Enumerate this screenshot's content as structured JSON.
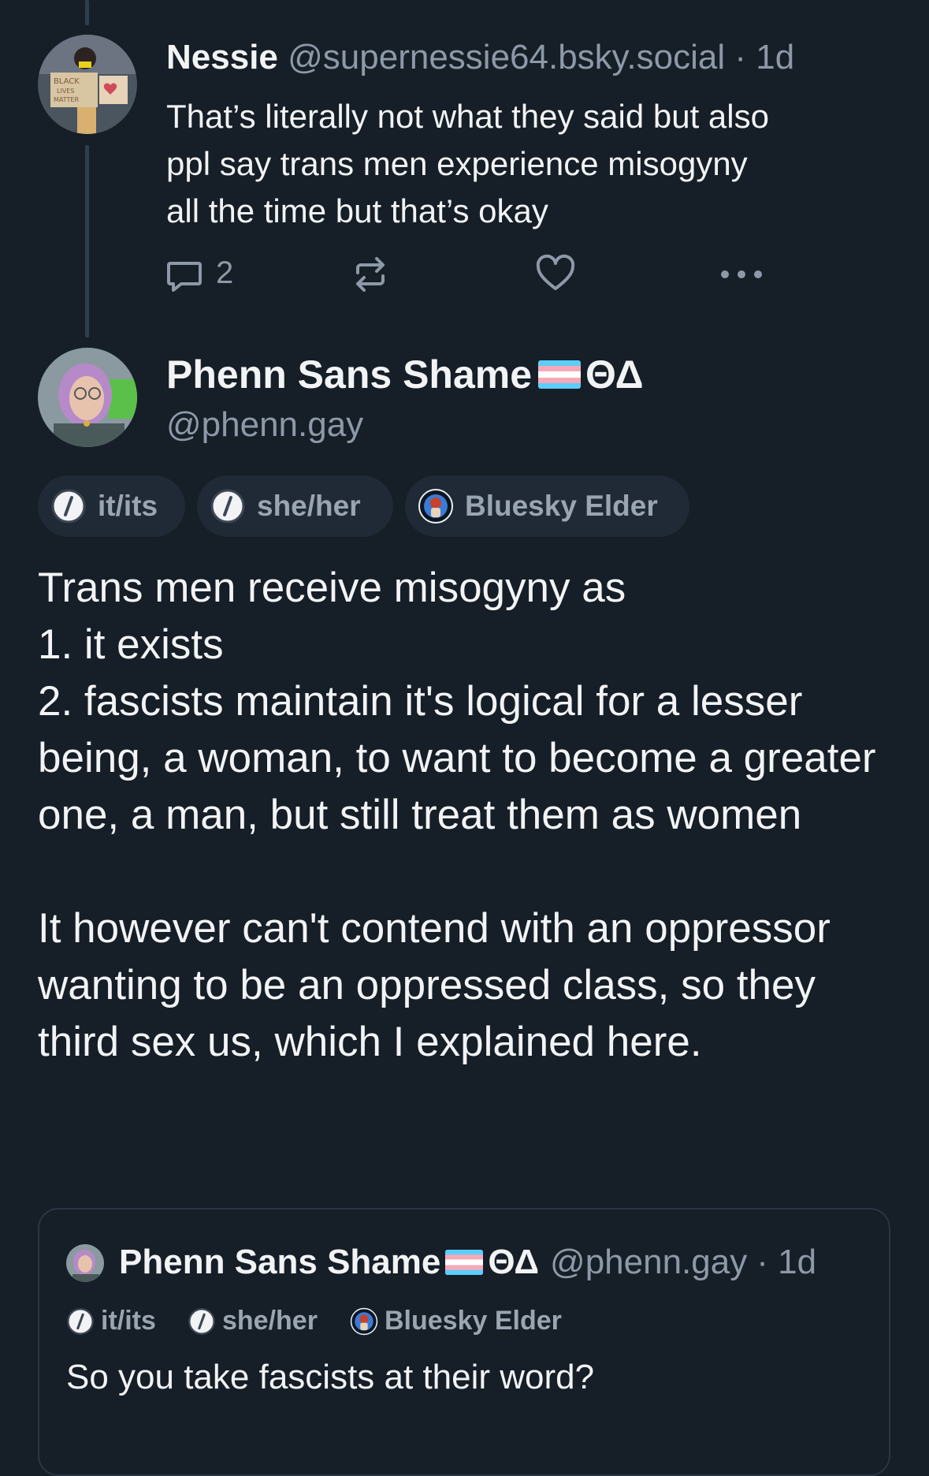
{
  "post1": {
    "author_name": "Nessie",
    "author_handle": "@supernessie64.bsky.social",
    "time": "· 1d",
    "text_lines": [
      "That’s literally not what they said but also",
      "ppl say trans men experience misogyny",
      "all the time but that’s okay"
    ],
    "reply_count": "2"
  },
  "post2": {
    "author_name": "Phenn Sans Shame",
    "name_suffix": "ΘΔ",
    "author_handle": "@phenn.gay",
    "badges": [
      "it/its",
      "she/her",
      "Bluesky Elder"
    ],
    "body": "Trans men receive misogyny as\n1. it exists\n2. fascists maintain it's logical for a lesser being, a woman, to want to become a greater one, a man, but still treat them as women\n\nIt however can't contend with an oppressor wanting to be an oppressed class, so they third sex us, which I explained here."
  },
  "quote": {
    "author_name": "Phenn Sans Shame",
    "name_suffix": "ΘΔ",
    "author_handle": "@phenn.gay",
    "time": "· 1d",
    "badges": [
      "it/its",
      "she/her",
      "Bluesky Elder"
    ],
    "text": "So you take fascists at their word?"
  },
  "colors": {
    "background": "#161e27",
    "text": "#f1f3f5",
    "muted": "#8d99a8",
    "trans_flag_blue": "#5bcefa",
    "trans_flag_pink": "#f5a9b8"
  },
  "icons": [
    "reply-icon",
    "repost-icon",
    "like-icon",
    "more-icon",
    "pronoun-icon",
    "elder-badge-icon",
    "trans-flag-icon"
  ]
}
